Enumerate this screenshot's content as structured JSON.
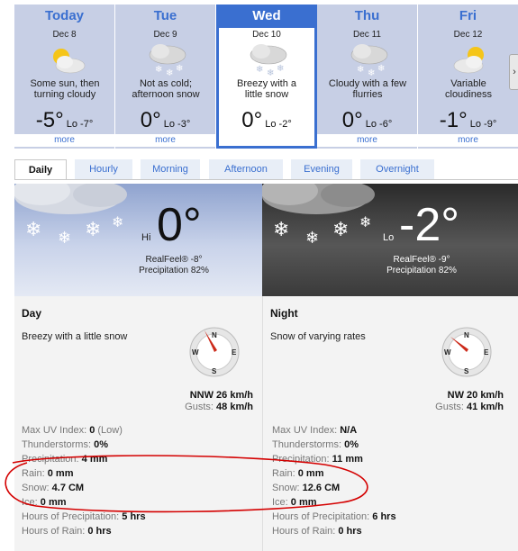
{
  "days": [
    {
      "name": "Today",
      "date": "Dec 8",
      "desc_line1": "Some sun, then",
      "desc_line2": "turning cloudy",
      "hi": "-5°",
      "lo": "Lo -7°",
      "more": "more",
      "icon": "sun-cloud-icon"
    },
    {
      "name": "Tue",
      "date": "Dec 9",
      "desc_line1": "Not as cold;",
      "desc_line2": "afternoon snow",
      "hi": "0°",
      "lo": "Lo -3°",
      "more": "more",
      "icon": "snow-cloud-icon"
    },
    {
      "name": "Wed",
      "date": "Dec 10",
      "desc_line1": "Breezy with a",
      "desc_line2": "little snow",
      "hi": "0°",
      "lo": "Lo -2°",
      "more": "more",
      "icon": "snow-cloud-icon"
    },
    {
      "name": "Thu",
      "date": "Dec 11",
      "desc_line1": "Cloudy with a few",
      "desc_line2": "flurries",
      "hi": "0°",
      "lo": "Lo -6°",
      "more": "more",
      "icon": "snow-cloud-icon"
    },
    {
      "name": "Fri",
      "date": "Dec 12",
      "desc_line1": "Variable",
      "desc_line2": "cloudiness",
      "hi": "-1°",
      "lo": "Lo -9°",
      "more": "more",
      "icon": "sun-cloud-icon"
    }
  ],
  "tabs": [
    "Daily",
    "Hourly",
    "Morning",
    "Afternoon",
    "Evening",
    "Overnight"
  ],
  "day_panel": {
    "label": "Hi",
    "temp": "0°",
    "realfeel": "RealFeel® -8°",
    "precip": "Precipitation 82%"
  },
  "night_panel": {
    "label": "Lo",
    "temp": "-2°",
    "realfeel": "RealFeel® -9°",
    "precip": "Precipitation 82%"
  },
  "day_details": {
    "title": "Day",
    "description": "Breezy with a little snow",
    "wind": "NNW 26 km/h",
    "gusts_label": "Gusts:",
    "gusts_value": "48 km/h",
    "uv_label": "Max UV Index:",
    "uv_value": "0",
    "uv_extra": "(Low)",
    "thunder_label": "Thunderstorms:",
    "thunder_value": "0%",
    "precip_label": "Precipitation:",
    "precip_value": "4 mm",
    "rain_label": "Rain:",
    "rain_value": "0 mm",
    "snow_label": "Snow:",
    "snow_value": "4.7 CM",
    "ice_label": "Ice:",
    "ice_value": "0 mm",
    "hop_label": "Hours of Precipitation:",
    "hop_value": "5 hrs",
    "hor_label": "Hours of Rain:",
    "hor_value": "0 hrs"
  },
  "night_details": {
    "title": "Night",
    "description": "Snow of varying rates",
    "wind": "NW 20 km/h",
    "gusts_label": "Gusts:",
    "gusts_value": "41 km/h",
    "uv_label": "Max UV Index:",
    "uv_value": "N/A",
    "thunder_label": "Thunderstorms:",
    "thunder_value": "0%",
    "precip_label": "Precipitation:",
    "precip_value": "11 mm",
    "rain_label": "Rain:",
    "rain_value": "0 mm",
    "snow_label": "Snow:",
    "snow_value": "12.6 CM",
    "ice_label": "Ice:",
    "ice_value": "0 mm",
    "hop_label": "Hours of Precipitation:",
    "hop_value": "6 hrs",
    "hor_label": "Hours of Rain:",
    "hor_value": "0 hrs"
  },
  "compass": {
    "n": "N",
    "s": "S",
    "e": "E",
    "w": "W"
  },
  "colors": {
    "accent": "#3a6fd0",
    "annotation": "#d40000",
    "needle": "#cc2a1a"
  }
}
